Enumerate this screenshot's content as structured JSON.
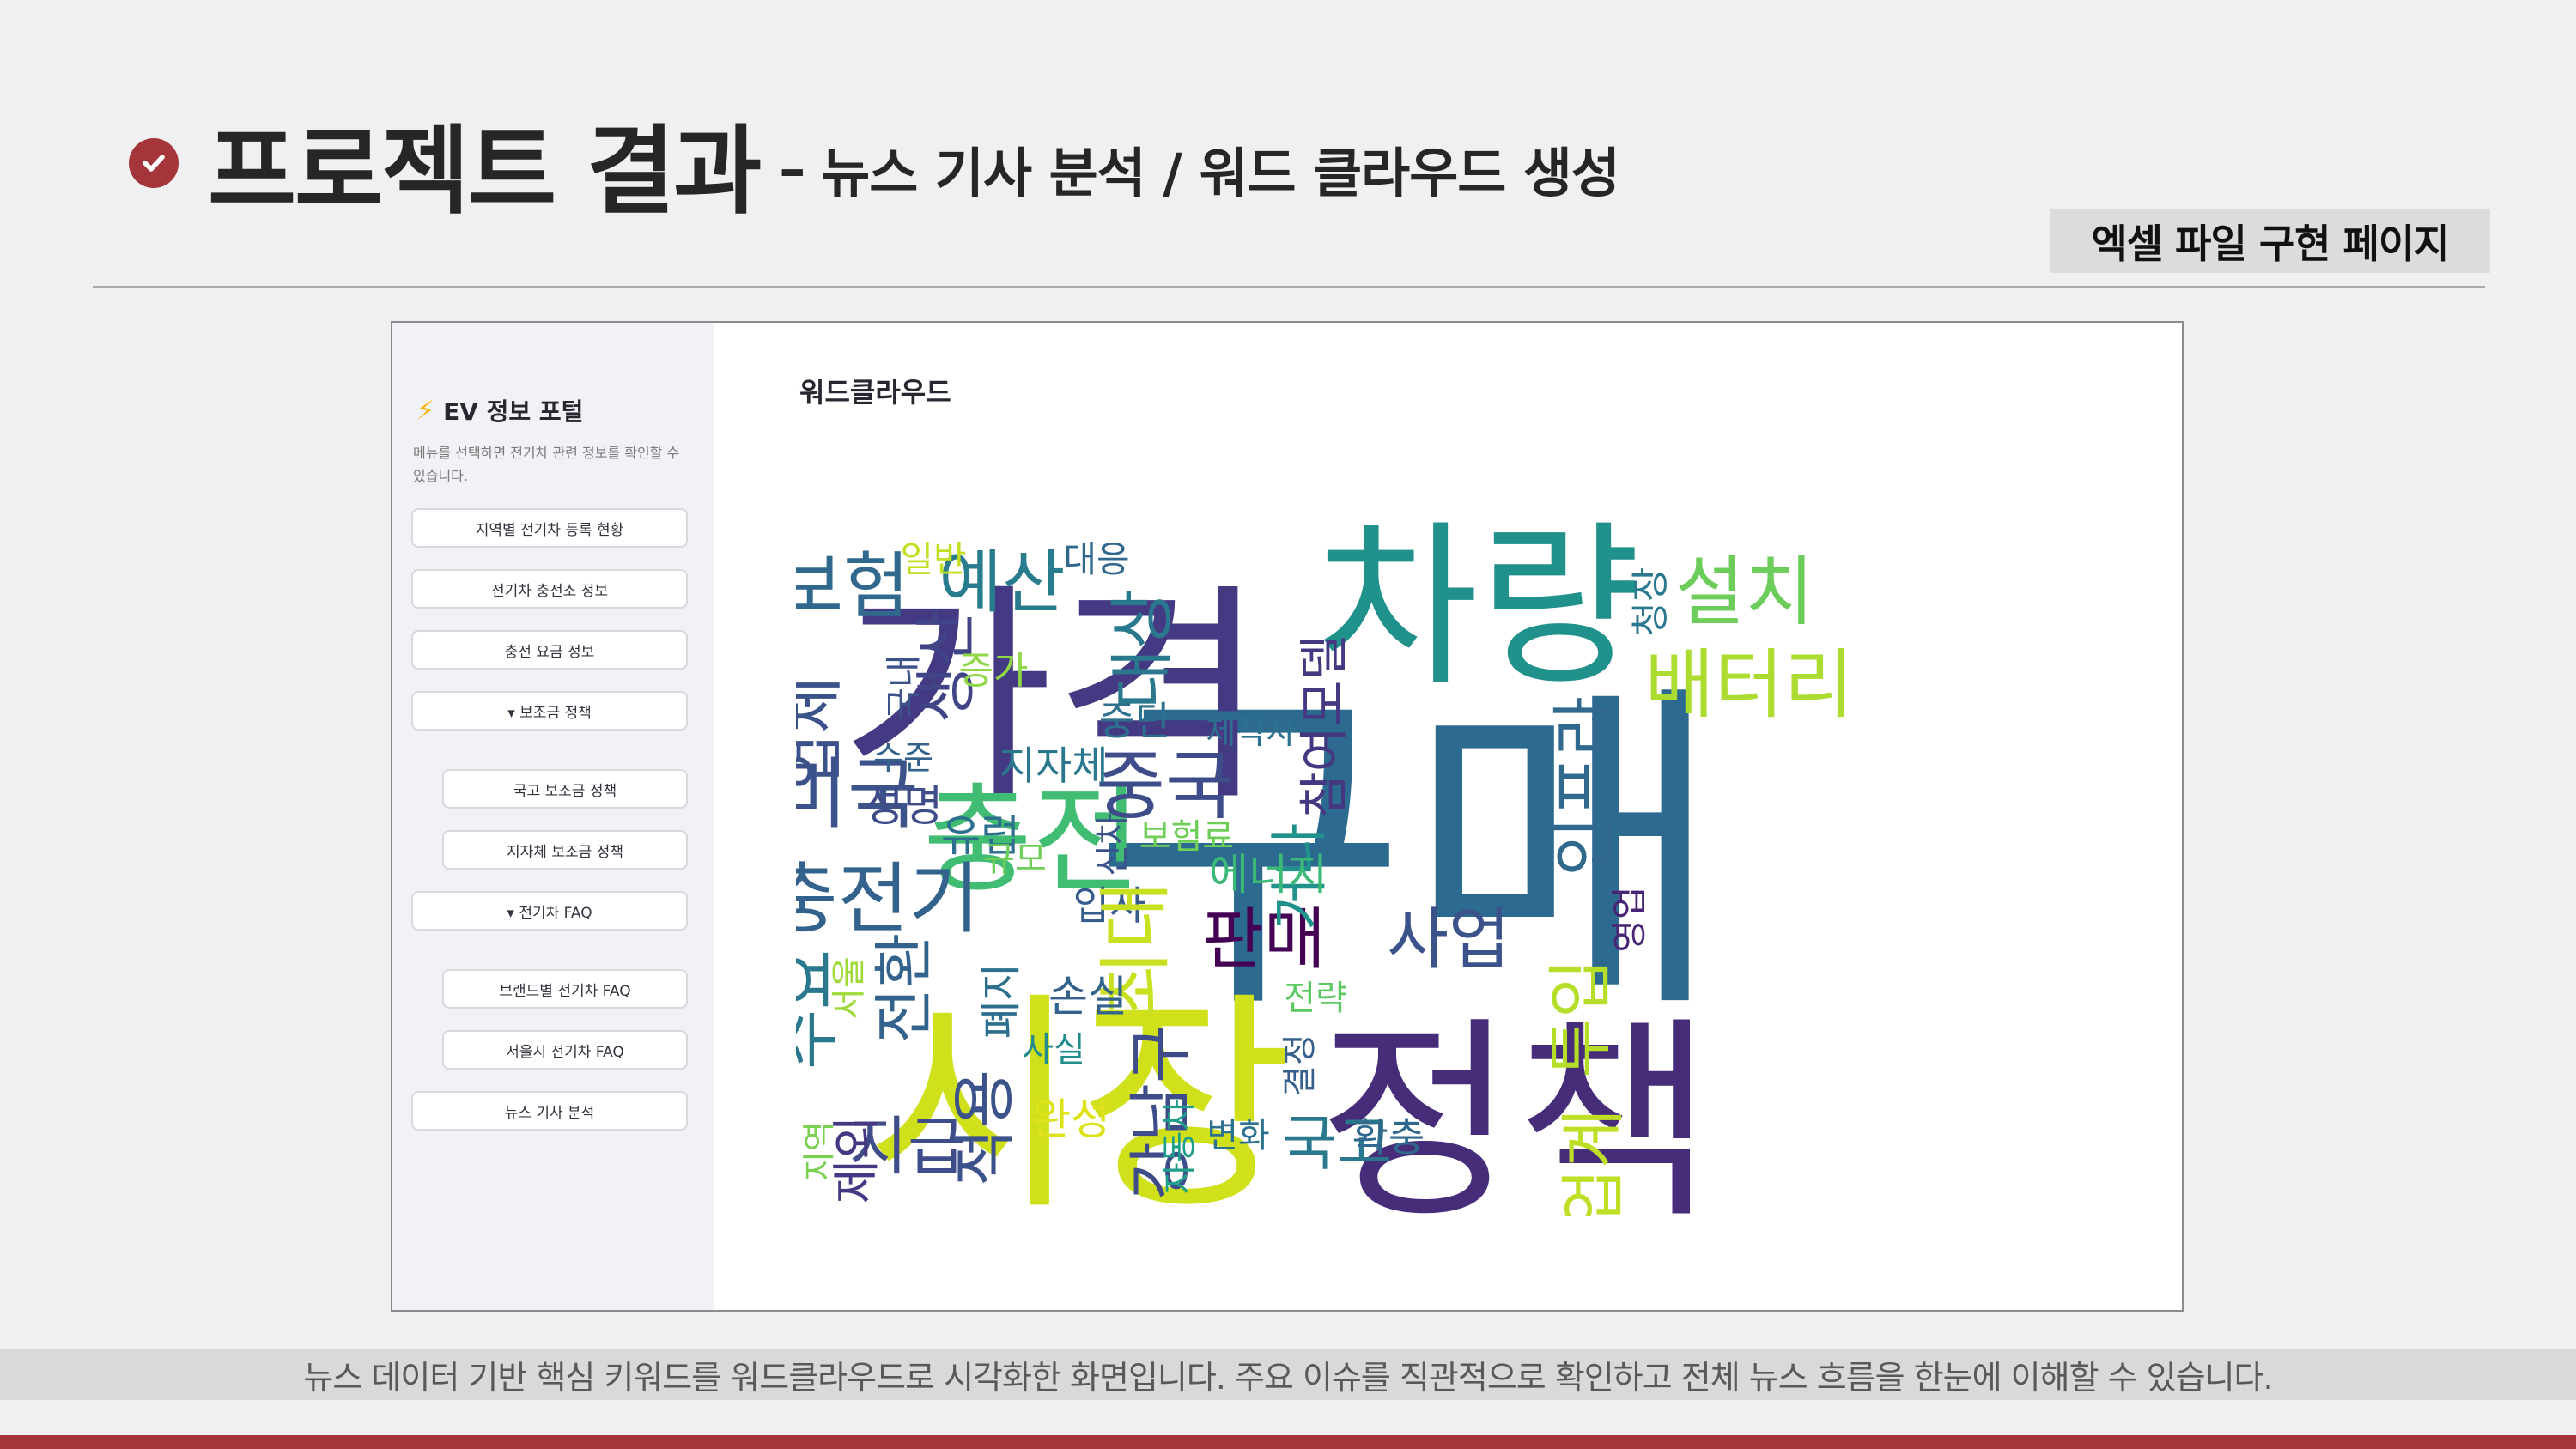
{
  "slide": {
    "title": "프로젝트 결과",
    "separator": "–",
    "subtitle": "뉴스 기사 분석 / 워드 클라우드 생성",
    "badge": "엑셀 파일 구현 페이지",
    "caption": "뉴스 데이터 기반 핵심 키워드를 워드클라우드로 시각화한 화면입니다. 주요 이슈를 직관적으로 확인하고 전체 뉴스 흐름을 한눈에 이해할 수 있습니다.",
    "colors": {
      "accent": "#a3353b",
      "badge_bg": "#dcdcdc",
      "caption_bg": "#d9d9d9"
    }
  },
  "app": {
    "portal_title": "EV 정보 포털",
    "portal_icon": "lightning-icon",
    "portal_desc": "메뉴를 선택하면 전기차 관련 정보를 확인할 수 있습니다.",
    "menu": [
      "지역별 전기차 등록 현황",
      "전기차 충전소 정보",
      "충전 요금 정보",
      "▾ 보조금 정책",
      "국고 보조금 정책",
      "지자체 보조금 정책",
      "▾ 전기차 FAQ",
      "브랜드별 전기차 FAQ",
      "서울시 전기차 FAQ",
      "뉴스 기사 분석"
    ],
    "main_heading": "워드클라우드"
  },
  "wordcloud": {
    "words": [
      "구매",
      "가격",
      "시장",
      "정책",
      "차량",
      "충전",
      "배터리",
      "설치",
      "보험",
      "예산",
      "대상",
      "충전기",
      "미국",
      "중국",
      "판매",
      "사업",
      "참여모델",
      "인프라",
      "투입",
      "업계",
      "업체",
      "생산",
      "증가",
      "국내",
      "일반",
      "대응",
      "중단",
      "제작사",
      "지자체",
      "수준",
      "성명",
      "유럽",
      "규모",
      "보험료",
      "신차",
      "거나",
      "에너지",
      "입사",
      "최대",
      "전환",
      "수요",
      "서울",
      "지급",
      "적용",
      "폐지",
      "손실",
      "사실",
      "완성",
      "강남구",
      "결정",
      "전략",
      "국고",
      "확충",
      "변화",
      "자동차",
      "지역",
      "제외",
      "영업",
      "청장"
    ]
  }
}
